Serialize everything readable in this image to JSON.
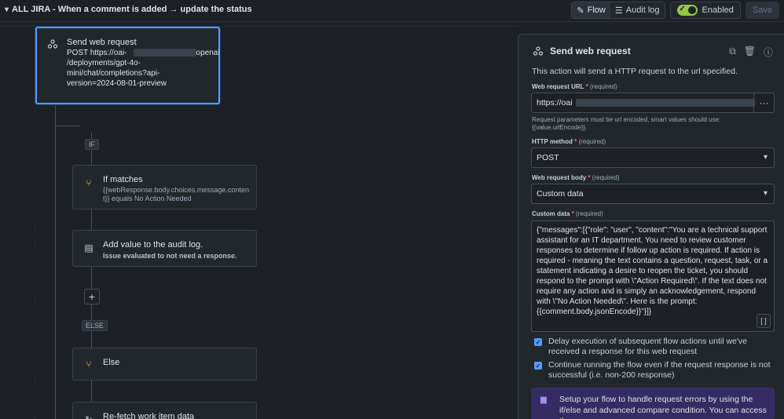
{
  "header": {
    "title": "ALL JIRA - When a comment is added → update the status",
    "flow_label": "Flow",
    "audit_label": "Audit log",
    "enabled_label": "Enabled",
    "save_label": "Save"
  },
  "canvas": {
    "selected_node": {
      "title": "Send web request",
      "line1": "POST https://oai-",
      "line1_tail": "openai",
      "line2": "/deployments/gpt-4o-",
      "line3": "mini/chat/completions?api-",
      "line4": "version=2024-08-01-preview"
    },
    "if_tag": "IF",
    "if_node": {
      "title": "If matches",
      "sub1": "{{webResponse.body.choices.message.conten",
      "sub2": "t}} equals No Action Needed"
    },
    "audit_node": {
      "title": "Add value to the audit log.",
      "sub": "Issue evaluated to not need a response."
    },
    "else_tag": "ELSE",
    "else_node": {
      "title": "Else"
    },
    "refetch_node": {
      "title": "Re-fetch work item data"
    },
    "plus_label": "+"
  },
  "panel": {
    "title": "Send web request",
    "description": "This action will send a HTTP request to the url specified.",
    "url_label": "Web request URL",
    "required_mark": "*",
    "required_text": "(required)",
    "url_value": "https://oai",
    "url_more": "···",
    "url_hint1": "Request parameters must be url encoded, smart values should use:",
    "url_hint2": "{{value.urlEncode}}.",
    "method_label": "HTTP method",
    "method_value": "POST",
    "body_label": "Web request body",
    "body_value": "Custom data",
    "custom_label": "Custom data",
    "custom_value": "{\"messages\":[{\"role\": \"user\", \"content\":\"You are a technical support assistant for an IT department. You need to review customer responses to determine if follow up action is required. If action is required - meaning the text contains a question, request, task, or a statement indicating a desire to reopen the ticket, you should respond to the prompt with \\\"Action Required\\\". If the text does not require any action and is simply an acknowledgement, respond with \\\"No Action Needed\\\". Here is the prompt: {{comment.body.jsonEncode}}\"}]}",
    "braces_label": "[ ]",
    "check1": "Delay execution of subsequent flow actions until we've received a response for this web request",
    "check2": "Continue running the flow even if the request response is not successful (i.e. non-200 response)",
    "info_text": "Setup your flow to handle request errors by using the if/else and advanced compare condition. You can access the"
  }
}
